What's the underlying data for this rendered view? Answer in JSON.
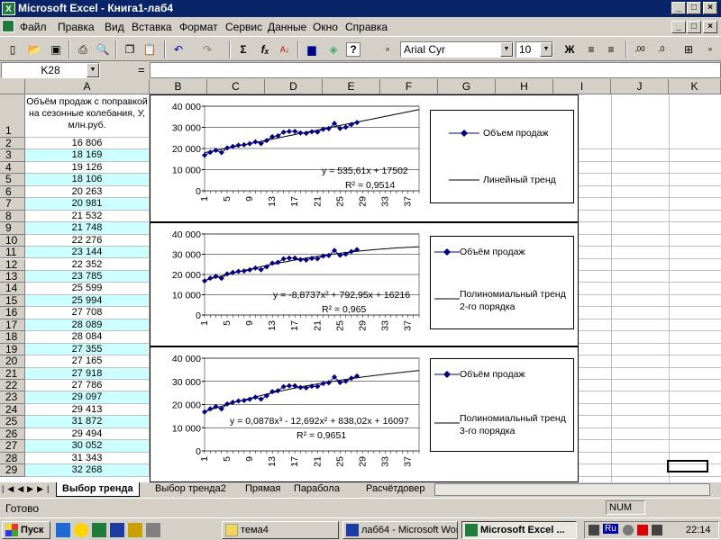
{
  "window": {
    "title": "Microsoft Excel - Книга1-лаб4"
  },
  "menu": [
    "Файл",
    "Правка",
    "Вид",
    "Вставка",
    "Формат",
    "Сервис",
    "Данные",
    "Окно",
    "Справка"
  ],
  "toolbar": {
    "font": "Arial Cyr",
    "size": "10",
    "bold": "Ж",
    "sigma": "Σ",
    "fx": "fₓ",
    "help": "?"
  },
  "namebox": "K28",
  "formula_eq": "=",
  "columns": [
    "A",
    "B",
    "C",
    "D",
    "E",
    "F",
    "G",
    "H",
    "I",
    "J",
    "K"
  ],
  "header_cell": "Объём продаж с поправкой на сезонные колебания, У, млн.руб.",
  "rows": [
    "16 806",
    "18 169",
    "19 126",
    "18 106",
    "20 263",
    "20 981",
    "21 532",
    "21 748",
    "22 276",
    "23 144",
    "22 352",
    "23 785",
    "25 599",
    "25 994",
    "27 708",
    "28 089",
    "28 084",
    "27 355",
    "27 165",
    "27 918",
    "27 786",
    "29 097",
    "29 413",
    "31 872",
    "29 494",
    "30 052",
    "31 343",
    "32 268"
  ],
  "chart_data": [
    {
      "type": "line",
      "series": [
        {
          "name": "Объем продаж",
          "values": [
            16806,
            18169,
            19126,
            18106,
            20263,
            20981,
            21532,
            21748,
            22276,
            23144,
            22352,
            23785,
            25599,
            25994,
            27708,
            28089,
            28084,
            27355,
            27165,
            27918,
            27786,
            29097,
            29413,
            31872,
            29494,
            30052,
            31343,
            32268
          ]
        }
      ],
      "x": [
        1,
        5,
        9,
        13,
        17,
        21,
        25,
        29,
        33,
        37
      ],
      "ylim": [
        0,
        40000
      ],
      "yticks": [
        "0",
        "10 000",
        "20 000",
        "30 000",
        "40 000"
      ],
      "trend": {
        "kind": "linear",
        "a": 535.61,
        "b": 17502
      },
      "equation": "y = 535,61x + 17502",
      "r2": "R² = 0,9514",
      "legend": [
        "Объем продаж",
        "Линейный тренд"
      ]
    },
    {
      "type": "line",
      "series": [
        {
          "name": "Объём продаж",
          "values": [
            16806,
            18169,
            19126,
            18106,
            20263,
            20981,
            21532,
            21748,
            22276,
            23144,
            22352,
            23785,
            25599,
            25994,
            27708,
            28089,
            28084,
            27355,
            27165,
            27918,
            27786,
            29097,
            29413,
            31872,
            29494,
            30052,
            31343,
            32268
          ]
        }
      ],
      "x": [
        1,
        5,
        9,
        13,
        17,
        21,
        25,
        29,
        33,
        37
      ],
      "ylim": [
        0,
        40000
      ],
      "yticks": [
        "0",
        "10 000",
        "20 000",
        "30 000",
        "40 000"
      ],
      "trend": {
        "kind": "poly2",
        "c2": -8.8737,
        "c1": 792.95,
        "c0": 16216
      },
      "equation": "y = -8,8737x² + 792,95x + 16216",
      "r2": "R² = 0,965",
      "legend": [
        "Объём продаж",
        "Полиномиальный тренд 2-го порядка"
      ]
    },
    {
      "type": "line",
      "series": [
        {
          "name": "Объём продаж",
          "values": [
            16806,
            18169,
            19126,
            18106,
            20263,
            20981,
            21532,
            21748,
            22276,
            23144,
            22352,
            23785,
            25599,
            25994,
            27708,
            28089,
            28084,
            27355,
            27165,
            27918,
            27786,
            29097,
            29413,
            31872,
            29494,
            30052,
            31343,
            32268
          ]
        }
      ],
      "x": [
        1,
        5,
        9,
        13,
        17,
        21,
        25,
        29,
        33,
        37
      ],
      "ylim": [
        0,
        40000
      ],
      "yticks": [
        "0",
        "10 000",
        "20 000",
        "30 000",
        "40 000"
      ],
      "trend": {
        "kind": "poly3",
        "c3": 0.0878,
        "c2": -12.692,
        "c1": 838.02,
        "c0": 16097
      },
      "equation": "y = 0,0878x³ - 12,692x² + 838,02x + 16097",
      "r2": "R² = 0,9651",
      "legend": [
        "Объём продаж",
        "Полиномиальный тренд 3-го порядка"
      ]
    }
  ],
  "sheets": [
    "Выбор тренда",
    "Выбор тренда2",
    "Прямая",
    "Парабола",
    "Расчётдовер"
  ],
  "status": {
    "ready": "Готово",
    "num": "NUM"
  },
  "taskbar": {
    "start": "Пуск",
    "tasks": [
      "тема4",
      "лаб64 - Microsoft Word",
      "Microsoft Excel ..."
    ],
    "lang": "Ru",
    "clock": "22:14"
  }
}
